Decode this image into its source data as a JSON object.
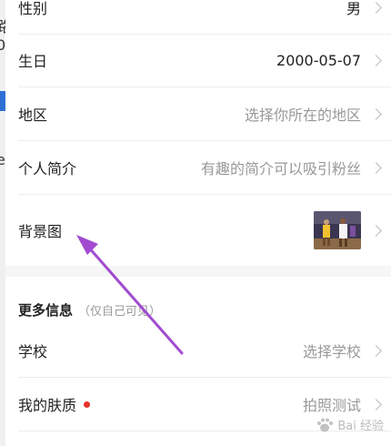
{
  "edge_fragments": [
    "路",
    "0",
    "e"
  ],
  "rows": [
    {
      "label": "性别",
      "value": "男"
    },
    {
      "label": "生日",
      "value": "2000-05-07"
    },
    {
      "label": "地区",
      "value": "选择你所在的地区"
    },
    {
      "label": "个人简介",
      "value": "有趣的简介可以吸引粉丝"
    },
    {
      "label": "背景图",
      "value": ""
    }
  ],
  "more_section": {
    "title": "更多信息",
    "note": "（仅自己可见）",
    "rows": [
      {
        "label": "学校",
        "value": "选择学校"
      },
      {
        "label": "我的肤质",
        "value": "拍照测试"
      }
    ]
  },
  "watermark": {
    "text": "Bai 经验"
  },
  "colors": {
    "annotation_arrow": "#a24bd0",
    "badge_dot": "#e5322d"
  }
}
